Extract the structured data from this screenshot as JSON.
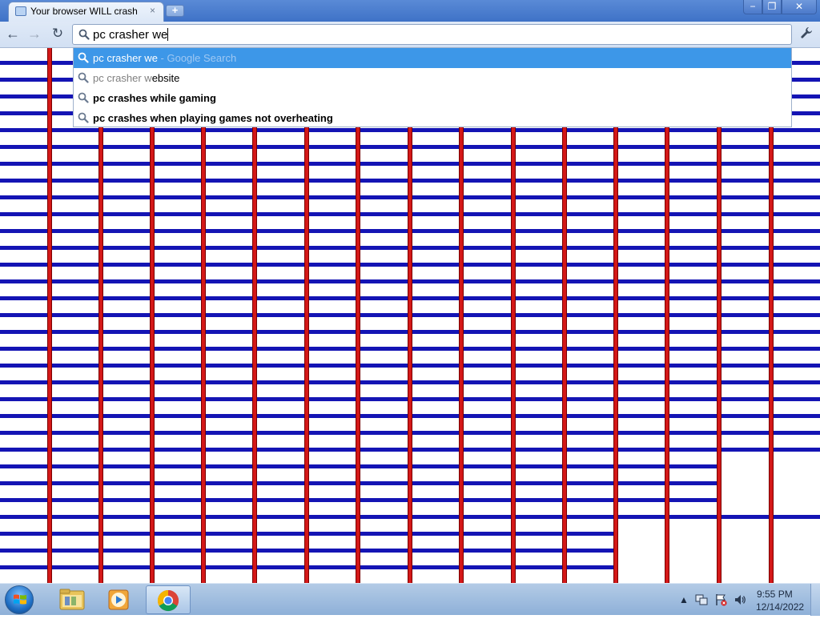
{
  "browser": {
    "tab_title": "Your browser WILL crash",
    "tab_close": "×",
    "new_tab": "+",
    "window_buttons": {
      "minimize": "−",
      "maximize": "❐",
      "close": "✕"
    }
  },
  "toolbar": {
    "back": "←",
    "forward": "→",
    "reload": "↻",
    "omnibox_value": "pc crasher we",
    "wrench": "🔧"
  },
  "suggestions": [
    {
      "typed": "pc crasher we",
      "rest": "",
      "hint": " - Google Search",
      "bold": false,
      "selected": true
    },
    {
      "typed": "pc crasher w",
      "rest": "ebsite",
      "hint": "",
      "bold": false,
      "selected": false
    },
    {
      "typed": "",
      "rest": "pc crashes while gaming",
      "hint": "",
      "bold": true,
      "selected": false
    },
    {
      "typed": "",
      "rest": "pc crashes when playing games not overheating",
      "hint": "",
      "bold": true,
      "selected": false
    }
  ],
  "page": {
    "horizontal_line_color": "#1414b4",
    "vertical_line_color": "#d41818",
    "vertical_line_edge_color": "#7a0000"
  },
  "taskbar": {
    "items": [
      "windows-explorer",
      "media-player",
      "google-chrome"
    ],
    "tray": {
      "time": "9:55 PM",
      "date": "12/14/2022"
    }
  }
}
